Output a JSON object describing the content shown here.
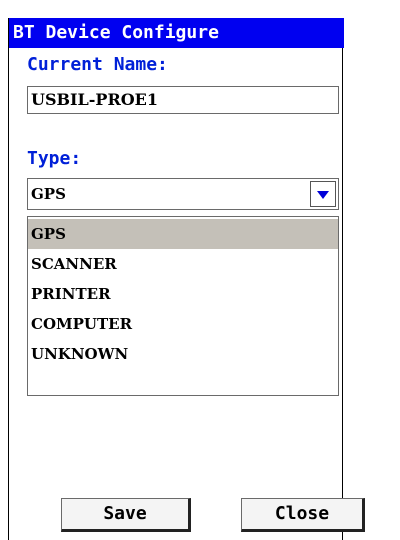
{
  "window": {
    "title": "BT Device Configure"
  },
  "current_name": {
    "label": "Current Name:",
    "value": "USBIL-PROE1"
  },
  "type": {
    "label": "Type:",
    "selected": "GPS",
    "options": [
      "GPS",
      "SCANNER",
      "PRINTER",
      "COMPUTER",
      "UNKNOWN"
    ],
    "highlighted_option": "GPS"
  },
  "buttons": {
    "save_label": "Save",
    "close_label": "Close"
  },
  "colors": {
    "title_bar": "#0000f0",
    "label_text": "#0020d8",
    "selection_highlight": "#c4c0b8"
  }
}
